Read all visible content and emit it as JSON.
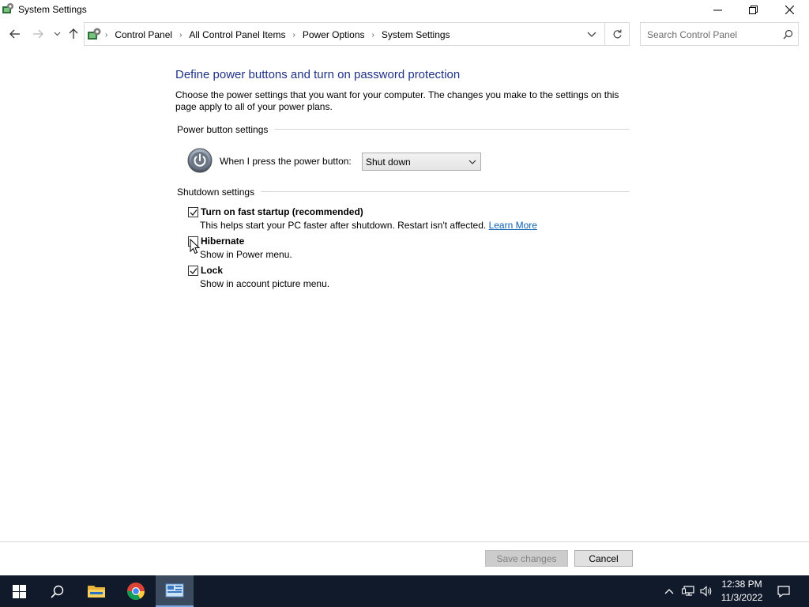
{
  "window": {
    "title": "System Settings"
  },
  "nav": {
    "breadcrumbs": [
      "Control Panel",
      "All Control Panel Items",
      "Power Options",
      "System Settings"
    ],
    "search_placeholder": "Search Control Panel"
  },
  "main": {
    "title": "Define power buttons and turn on password protection",
    "intro": "Choose the power settings that you want for your computer. The changes you make to the settings on this page apply to all of your power plans.",
    "power_group_header": "Power button settings",
    "power_button_label": "When I press the power button:",
    "power_button_value": "Shut down",
    "shutdown_group_header": "Shutdown settings",
    "options": [
      {
        "label": "Turn on fast startup (recommended)",
        "description": "This helps start your PC faster after shutdown. Restart isn't affected.",
        "link": "Learn More",
        "checked": true
      },
      {
        "label": "Hibernate",
        "description": "Show in Power menu.",
        "checked": false
      },
      {
        "label": "Lock",
        "description": "Show in account picture menu.",
        "checked": true
      }
    ]
  },
  "footer": {
    "save_label": "Save changes",
    "cancel_label": "Cancel"
  },
  "taskbar": {
    "time": "12:38 PM",
    "date": "11/3/2022",
    "icons": [
      "windows-start-icon",
      "search-icon",
      "file-explorer-icon",
      "chrome-icon",
      "control-panel-icon"
    ],
    "tray_icons": [
      "chevron-up-icon",
      "network-icon",
      "volume-icon",
      "notification-icon"
    ]
  },
  "colors": {
    "title_blue": "#1e3287",
    "link_blue": "#0b5fb3",
    "taskbar": "#101a2b"
  }
}
